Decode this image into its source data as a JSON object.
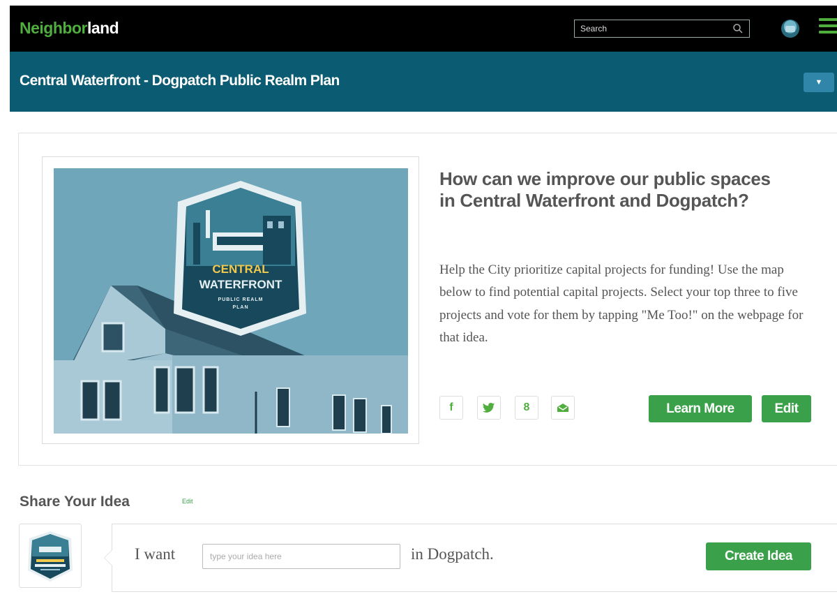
{
  "header": {
    "logo_part1": "Neighbor",
    "logo_part2": "land",
    "search_placeholder": "Search",
    "menu_icon": "hamburger-menu-icon",
    "accent": "#4fae3d",
    "bar_color": "#000000"
  },
  "subheader": {
    "title": "Central Waterfront - Dogpatch Public Realm Plan",
    "dropdown_label": "▼",
    "bar_color": "#0b5c72"
  },
  "hero": {
    "badge_line1": "CENTRAL",
    "badge_line2": "WATERFRONT",
    "badge_line3": "PUBLIC REALM",
    "badge_line4": "PLAN"
  },
  "question": {
    "headline": "How can we improve our public spaces in Central Waterfront and Dogpatch?",
    "description": "Help the City prioritize capital projects for funding! Use the map below to find potential capital projects. Select your top three to five projects and vote for them by tapping \"Me Too!\" on the webpage for that idea."
  },
  "social": {
    "facebook": "f",
    "twitter": "twitter-bird",
    "google": "8",
    "email": "envelope"
  },
  "actions": {
    "learn_more": "Learn More",
    "edit": "Edit",
    "button_color": "#3aa14a"
  },
  "share": {
    "title": "Share Your Idea",
    "edit_link": "Edit",
    "i_want": "I want",
    "input_placeholder": "type your idea here",
    "in_place": "in Dogpatch.",
    "create_button": "Create Idea"
  }
}
